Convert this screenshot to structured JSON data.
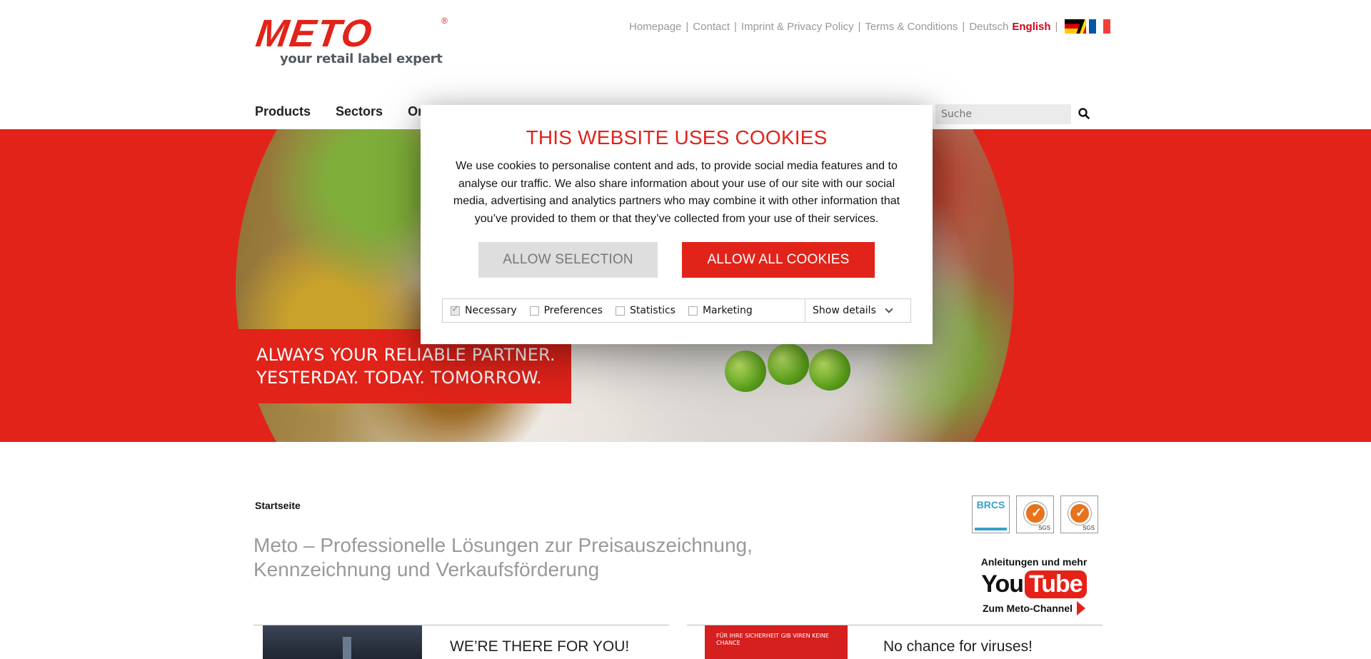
{
  "header": {
    "logo_text": "METO",
    "logo_reg": "®",
    "logo_tagline": "your retail label expert",
    "topnav": [
      "Homepage",
      "Contact",
      "Imprint & Privacy Policy",
      "Terms & Conditions"
    ],
    "lang_de": "Deutsch",
    "lang_en": "English",
    "separator": "|"
  },
  "mainnav": [
    "Products",
    "Sectors",
    "On"
  ],
  "search": {
    "placeholder": "Suche",
    "icon": "search-icon"
  },
  "hero": {
    "banner_line1": "ALWAYS YOUR RELIABLE PARTNER.",
    "banner_line2": "YESTERDAY. TODAY. TOMORROW."
  },
  "cookie_dialog": {
    "title": "THIS WEBSITE USES COOKIES",
    "body": "We use cookies to personalise content and ads, to provide social media features and to analyse our traffic. We also share information about your use of our site with our social media, advertising and analytics partners who may combine it with other information that you’ve provided to them or that they’ve collected from your use of their services.",
    "allow_selection": "ALLOW SELECTION",
    "allow_all": "ALLOW ALL COOKIES",
    "options": [
      {
        "label": "Necessary",
        "checked": true
      },
      {
        "label": "Preferences",
        "checked": false
      },
      {
        "label": "Statistics",
        "checked": false
      },
      {
        "label": "Marketing",
        "checked": false
      }
    ],
    "show_details": "Show details"
  },
  "content": {
    "breadcrumb": "Startseite",
    "headline_line1": "Meto – Professionelle Lösungen zur Preisauszeichnung,",
    "headline_line2": "Kennzeichnung und Verkaufsförderung",
    "cert_brcs": "BRCS",
    "cert_sgs": "SGS",
    "youtube_top": "Anleitungen und mehr",
    "youtube_you": "You",
    "youtube_tube": "Tube",
    "youtube_bottom": "Zum Meto-Channel",
    "card_left_title": "WE’RE THERE FOR YOU!",
    "card_right_title": "No chance for viruses!",
    "card_right_img_text": "FÜR IHRE SICHERHEIT GIB VIREN KEINE CHANCE"
  },
  "colors": {
    "brand_red": "#e2231a",
    "link_grey": "#999999"
  }
}
